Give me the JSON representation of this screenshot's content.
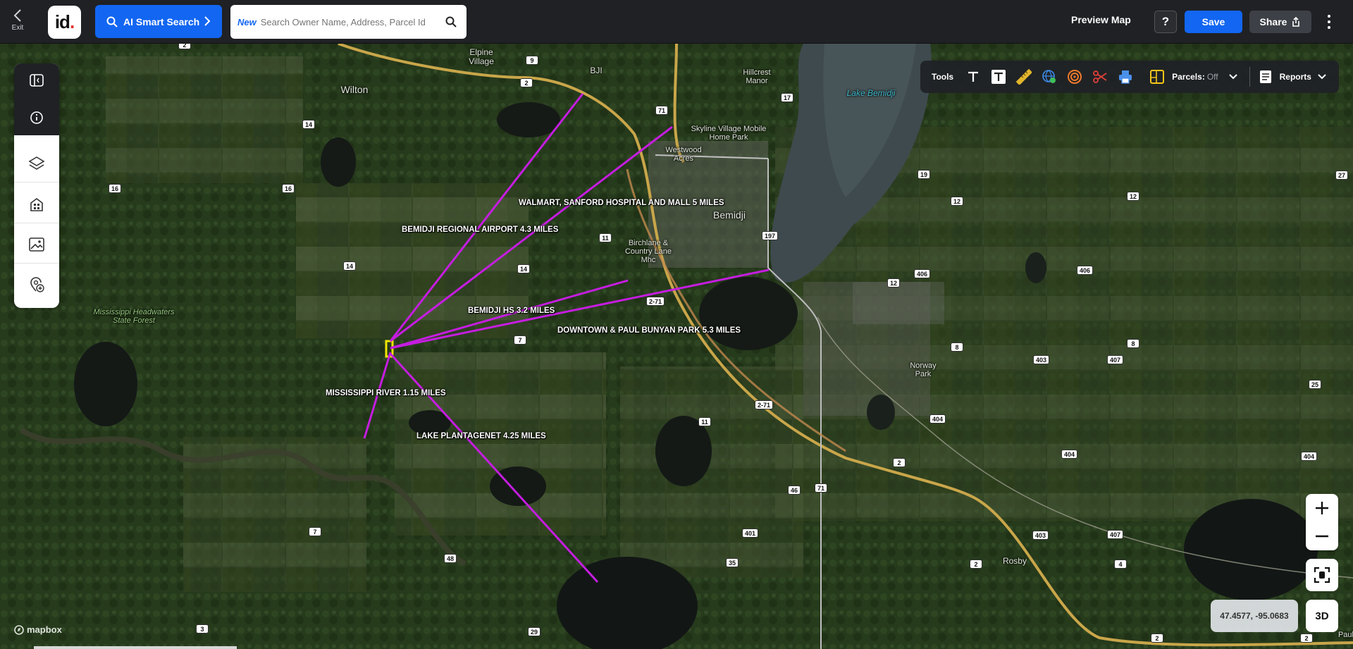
{
  "topbar": {
    "exit_label": "Exit",
    "logo_text": "id",
    "logo_dot": ".",
    "ai_search_label": "AI Smart Search",
    "search_new_tag": "New",
    "search_placeholder": "Search Owner Name, Address, Parcel Id",
    "preview_map_label": "Preview Map",
    "help_label": "?",
    "save_label": "Save",
    "share_label": "Share"
  },
  "tools": {
    "label": "Tools",
    "items": [
      "text-icon",
      "text-box-icon",
      "ruler-icon",
      "globe-icon",
      "radius-icon",
      "scissors-icon",
      "print-icon"
    ],
    "parcels_label": "Parcels:",
    "parcels_value": "Off",
    "reports_label": "Reports"
  },
  "left_rail": {
    "items": [
      "sidebar-toggle-icon",
      "info-icon",
      "layers-icon",
      "buildings-icon",
      "image-icon",
      "add-location-icon"
    ]
  },
  "map": {
    "attribution": "mapbox",
    "coordinates": "47.4577, -95.0683",
    "view_3d_label": "3D",
    "annotations": [
      "WALMART, SANFORD HOSPITAL AND MALL 5 MILES",
      "BEMIDJI REGIONAL AIRPORT 4.3 MILES",
      "BEMIDJI HS 3.2 MILES",
      "DOWNTOWN & PAUL BUNYAN PARK 5.3 MILES",
      "MISSISSIPPI RIVER 1.15 MILES",
      "LAKE PLANTAGENET 4.25 MILES"
    ],
    "place_names": {
      "elpine_village": "Elpine Village",
      "bji": "BJI",
      "hillcrest_manor": "Hillcrest Manor",
      "lake_bemidji": "Lake Bemidji",
      "wilton": "Wilton",
      "skyline": "Skyline Village Mobile Home Park",
      "westwood": "Westwood Acres",
      "bemidji": "Bemidji",
      "birchlane": "Birchlane & Country Lane Mhc",
      "headwaters": "Mississippi Headwaters State Forest",
      "norway_park": "Norway Park",
      "rosby": "Rosby",
      "paul": "Paul"
    },
    "road_shields": [
      "2",
      "9",
      "2",
      "71",
      "17",
      "14",
      "16",
      "16",
      "19",
      "27",
      "12",
      "12",
      "11",
      "197",
      "14",
      "14",
      "406",
      "12",
      "406",
      "2-71",
      "7",
      "8",
      "8",
      "403",
      "407",
      "25",
      "2-71",
      "11",
      "404",
      "404",
      "2",
      "71",
      "46",
      "404",
      "401",
      "35",
      "2",
      "4",
      "403",
      "407",
      "7",
      "48",
      "3",
      "29",
      "2",
      "2"
    ],
    "colors": {
      "route_line": "#c51de0",
      "subject_parcel": "#f2e600",
      "accent": "#1266f1"
    }
  }
}
